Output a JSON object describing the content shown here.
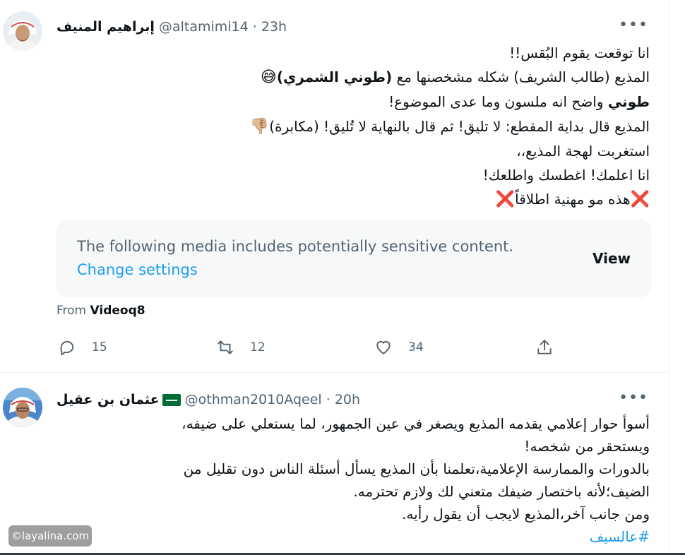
{
  "tweet1": {
    "display_name": "إبراهيم المنيف",
    "handle": "@altamimi14",
    "time": "23h",
    "more_label": "•••",
    "lines": [
      "انا توقعت يقوم البُقس!!",
      [
        "المذيع (طالب الشريف) شكله مشخصنها مع ",
        "(طوني الشمري)",
        "😅"
      ],
      [
        "طوني",
        " واضح انه ملسون وما عدى الموضوع!"
      ],
      [
        "المذيع قال بداية المقطع: لا تليق! ثم قال بالنهاية لا تُليق! (مكابرة)",
        "👎🏼"
      ],
      "استغربت لهجة المذيع،،",
      "انا اعلمك! اغطسك واطلعك!",
      [
        "❌",
        "هذه مو مهنية اطلاقاً",
        "❌"
      ]
    ],
    "media_warning": "The following media includes potentially sensitive content.",
    "media_settings": "Change settings",
    "media_view": "View",
    "from_label": "From",
    "from_source": "Videoq8",
    "replies": "15",
    "retweets": "12",
    "likes": "34"
  },
  "tweet2": {
    "display_name": "عثمان بن عقيل",
    "handle": "@othman2010Aqeel",
    "time": "20h",
    "more_label": "•••",
    "lines": [
      "أسوأ حوار إعلامي يقدمه المذيع ويصغر في عين الجمهور، لما يستعلي على ضيفه،",
      "ويستحقر من شخصه!",
      "بالدورات والممارسة الإعلامية،تعلمنا بأن المذيع يسأل أسئلة الناس دون تقليل من",
      "الضيف؛لأنه باختصار ضيفك متعني لك ولازم تحترمه.",
      "ومن جانب آخر،المذيع لايجب أن يقول رأيه."
    ],
    "hashtag": "#عالسيف"
  },
  "watermark": "©layalina.com",
  "colors": {
    "accent": "#1d9bf0",
    "secondary_text": "#536471",
    "primary_text": "#0f1419"
  }
}
